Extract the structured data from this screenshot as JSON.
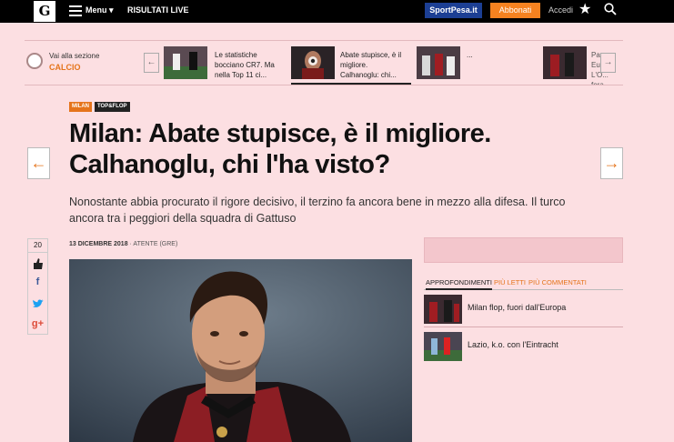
{
  "header": {
    "logo": "G",
    "menu_label": "Menu ▾",
    "risultati_label": "RISULTATI LIVE",
    "sportpesa_label": "SportPesa.it",
    "abbonati_label": "Abbonati",
    "accedi_label": "Accedi",
    "icons": [
      "hamburger-icon",
      "star-icon",
      "search-icon"
    ]
  },
  "section": {
    "label": "Vai alla sezione",
    "name": "CALCIO",
    "prev": "←",
    "next": "→",
    "items": [
      {
        "text": "Le statistiche bocciano CR7. Ma nella Top 11 ci..."
      },
      {
        "text": "Abate stupisce, è il migliore. Calhanoglu: chi..."
      },
      {
        "text": "..."
      },
      {
        "text": "Pa... Eu... L'O... fora..."
      }
    ]
  },
  "article": {
    "tags": [
      "MILAN",
      "TOP&FLOP"
    ],
    "title": "Milan: Abate stupisce, è il migliore. Calhanoglu, chi l'ha visto?",
    "subtitle": "Nonostante abbia procurato il rigore decisivo, il terzino fa ancora bene in mezzo alla difesa. Il turco ancora tra i peggiori della squadra di Gattuso",
    "date": "13 DICEMBRE 2018",
    "author": "· ATENTE (GRE)",
    "prev_arrow": "←",
    "next_arrow": "→"
  },
  "share": {
    "count": "20",
    "icons": [
      "thumbs-up-icon",
      "facebook-icon",
      "twitter-icon",
      "google-plus-icon"
    ],
    "fb": "f",
    "gplus": "g+"
  },
  "sidebar": {
    "tabs": [
      "APPROFONDIMENTI",
      "PIÙ LETTI",
      "PIÙ COMMENTATI"
    ],
    "related": [
      {
        "title": "Milan flop, fuori dall'Europa"
      },
      {
        "title": "Lazio, k.o. con l'Eintracht"
      }
    ]
  },
  "colors": {
    "background": "#fcdfe2",
    "accent": "#e5741b",
    "sportpesa": "#1c3f94"
  }
}
